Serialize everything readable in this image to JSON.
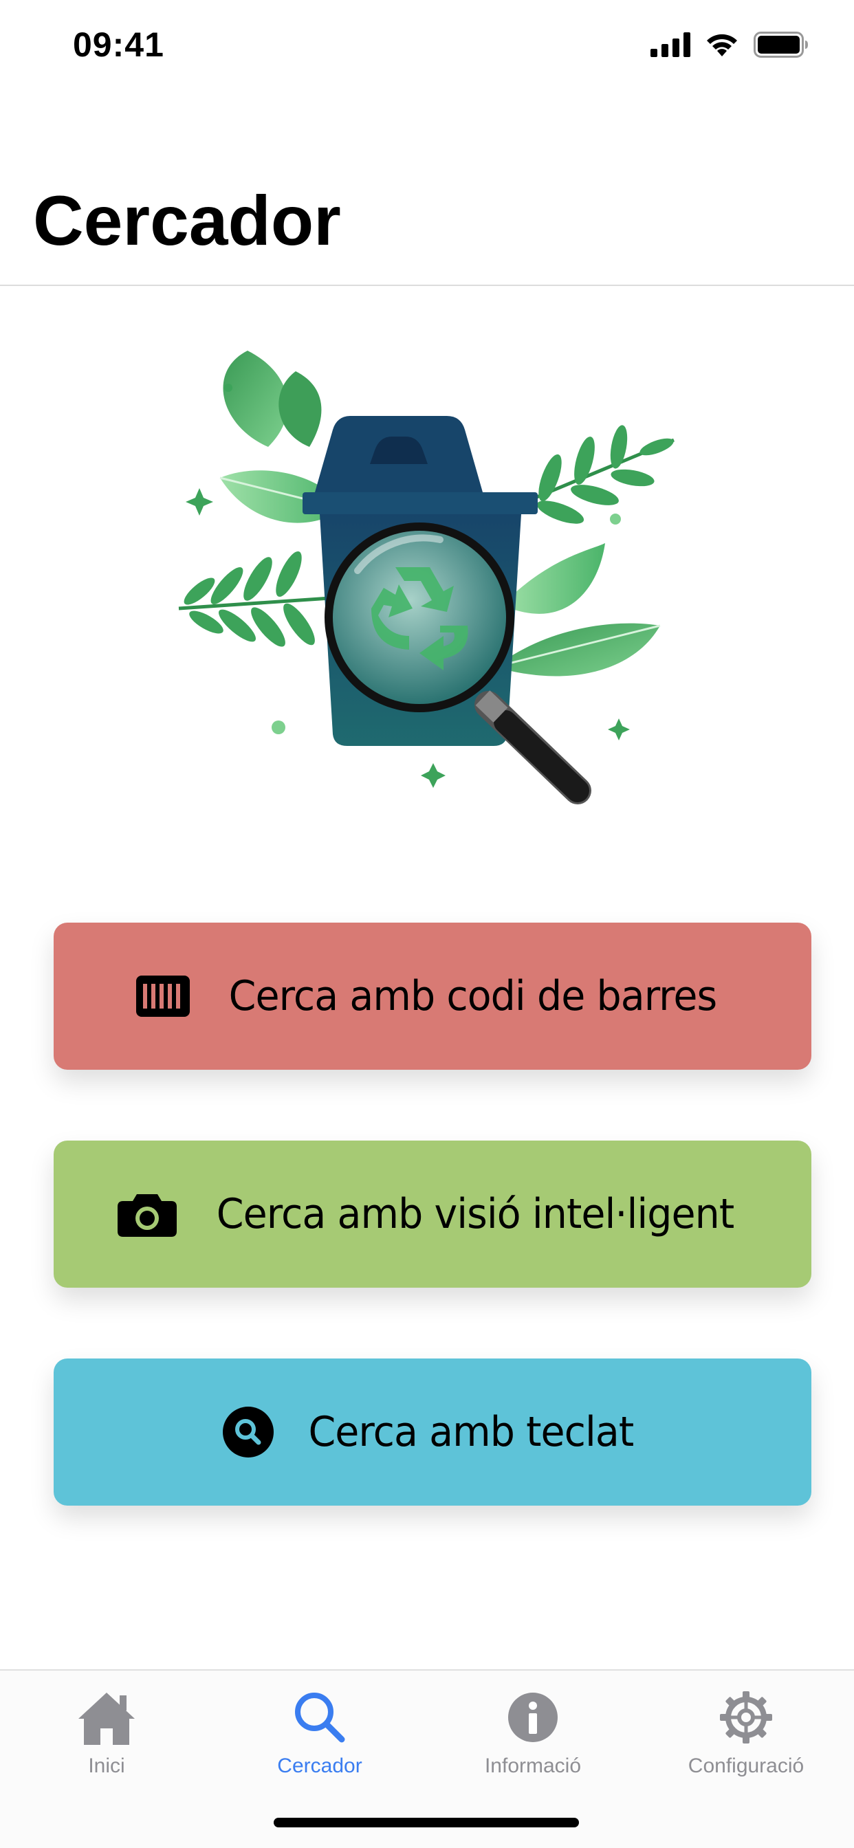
{
  "status_bar": {
    "time": "09:41"
  },
  "header": {
    "title": "Cercador"
  },
  "actions": [
    {
      "label": "Cerca amb codi de barres",
      "icon": "barcode-icon",
      "color": "#d87a74"
    },
    {
      "label": "Cerca amb visió intel·ligent",
      "icon": "camera-icon",
      "color": "#a6ca74"
    },
    {
      "label": "Cerca amb teclat",
      "icon": "search-circle-icon",
      "color": "#5ec3d8"
    }
  ],
  "tab_bar": {
    "tabs": [
      {
        "label": "Inici",
        "icon": "home-icon",
        "active": false
      },
      {
        "label": "Cercador",
        "icon": "search-icon",
        "active": true
      },
      {
        "label": "Informació",
        "icon": "info-icon",
        "active": false
      },
      {
        "label": "Configuració",
        "icon": "gear-icon",
        "active": false
      }
    ],
    "active_color": "#3a7df0",
    "inactive_color": "#8e8e93"
  }
}
